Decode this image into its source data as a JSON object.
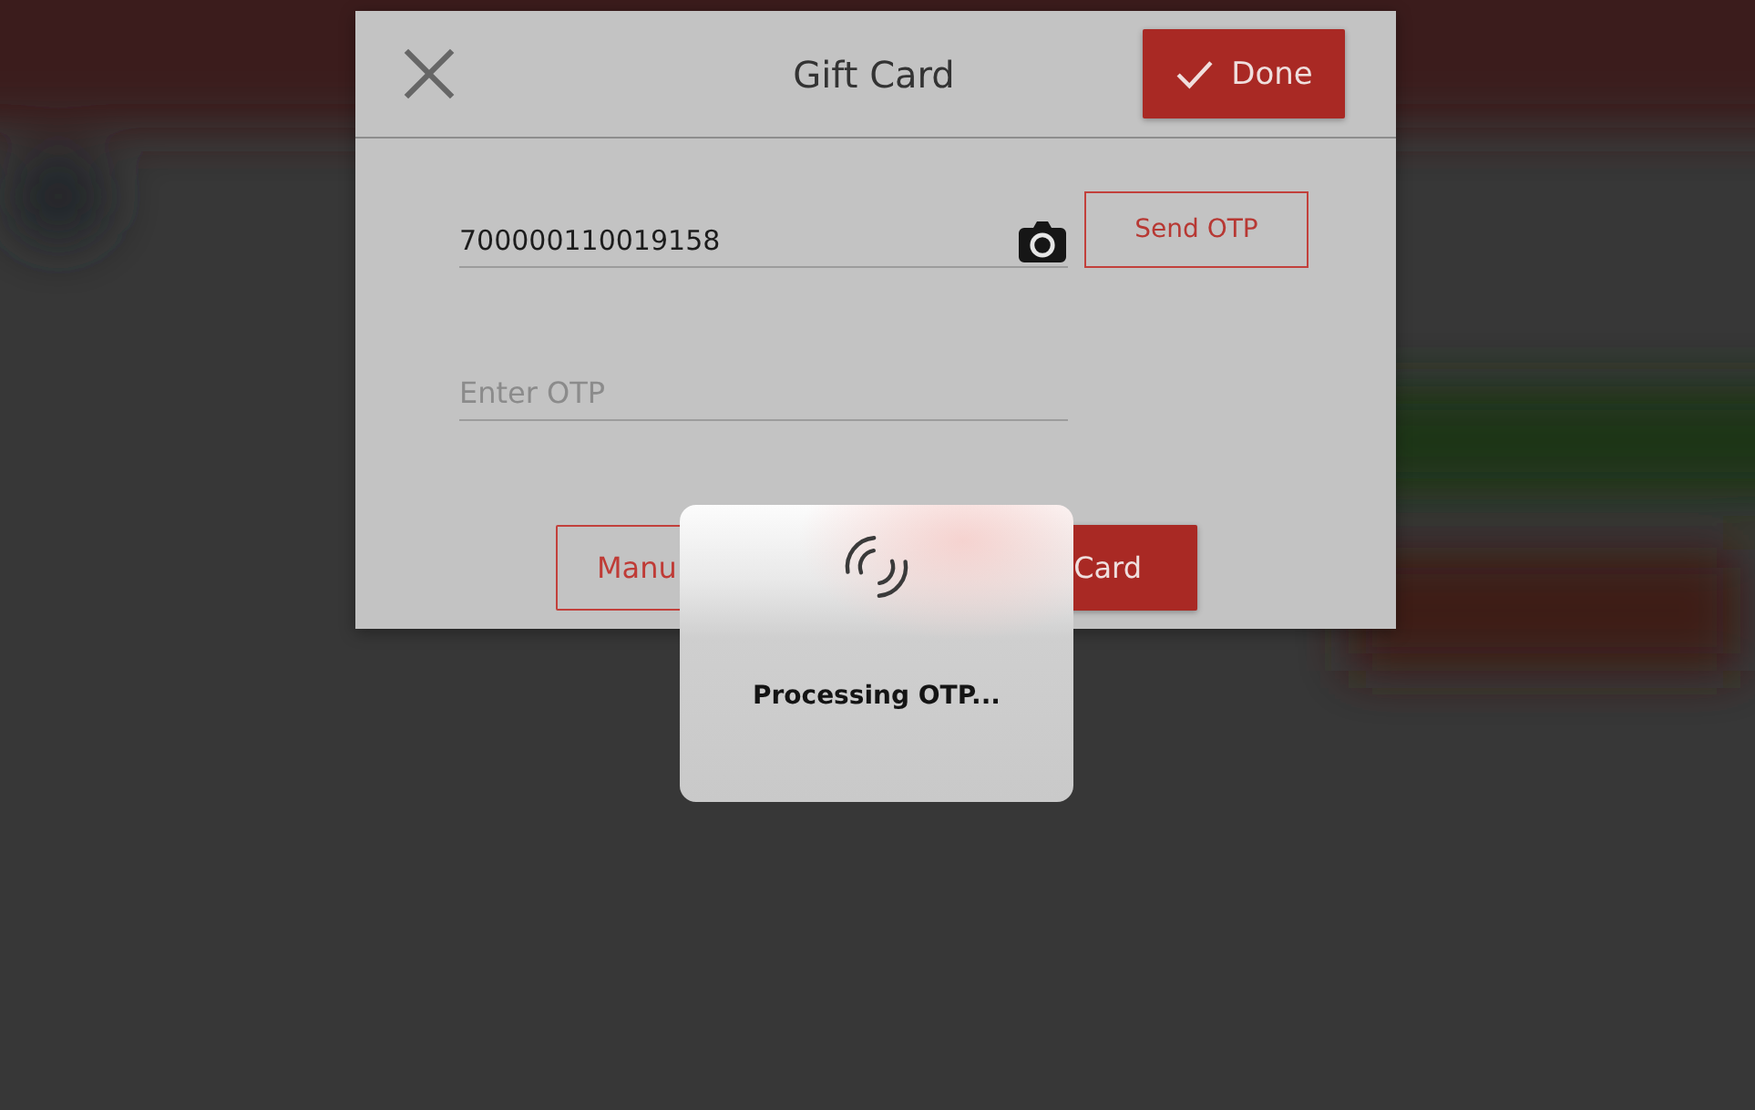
{
  "dialog": {
    "title": "Gift Card",
    "done_button": "Done"
  },
  "card_number_field": {
    "value": "700000110019158"
  },
  "send_otp_button": "Send OTP",
  "otp_field": {
    "placeholder": "Enter OTP"
  },
  "footer_buttons": [
    {
      "label": "Manu",
      "kind": "outline"
    },
    {
      "label": "Card",
      "kind": "filled"
    }
  ],
  "loading_popup": {
    "message": "Processing OTP..."
  }
}
